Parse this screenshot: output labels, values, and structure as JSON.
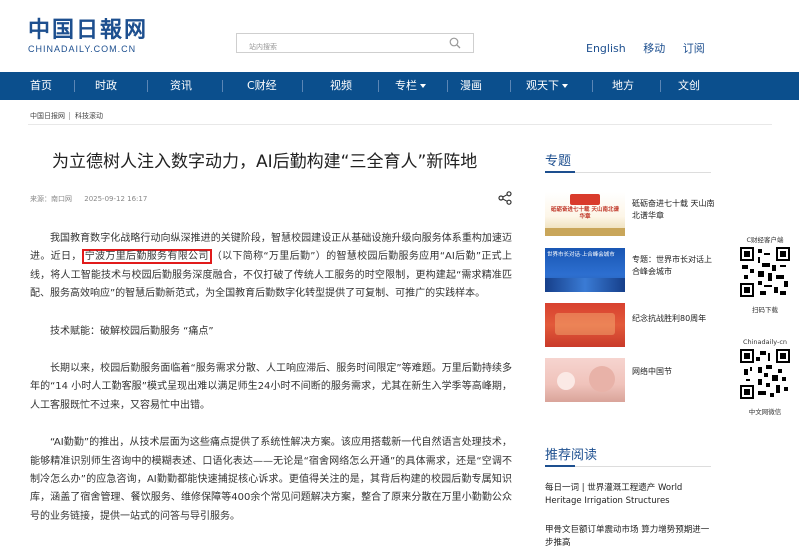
{
  "header": {
    "logo_main": "中国日報网",
    "logo_sub": "CHINADAILY.COM.CN",
    "search_placeholder": "站内搜索",
    "links": [
      "English",
      "移动",
      "订阅"
    ]
  },
  "nav": {
    "items": [
      "首页",
      "时政",
      "资讯",
      "C财经",
      "视频",
      "专栏",
      "漫画",
      "观天下",
      "地方",
      "文创"
    ],
    "dropdown_items": [
      "专栏",
      "观天下"
    ]
  },
  "breadcrumb": [
    "中国日报网",
    "科技滚动"
  ],
  "article": {
    "title": "为立德树人注入数字动力，AI后勤构建“三全育人”新阵地",
    "source": "来源：南口网",
    "date": "2025-09-12 16:17",
    "p1_a": "我国教育数字化战略行动向纵深推进的关键阶段，智慧校园建设正从基础设施升级向服务体系重构加速迈进。近日，",
    "p1_highlight": "宁波万里后勤服务有限公司",
    "p1_b": "（以下简称“万里后勤”）的智慧校园后勤服务应用“AI后勤”正式上线，将人工智能技术与校园后勤服务深度融合，不仅打破了传统人工服务的时空限制，更构建起“需求精准匹配、服务高效响应”的智慧后勤新范式，为全国教育后勤数字化转型提供了可复制、可推广的实践样本。",
    "p2": "技术赋能：破解校园后勤服务 “痛点”",
    "p3": "长期以来，校园后勤服务面临着“服务需求分散、人工响应滞后、服务时间限定”等难题。万里后勤持续多年的“14 小时人工勤客服”模式呈现出难以满足师生24小时不间断的服务需求，尤其在新生入学季等高峰期，人工客服既忙不过来，又容易忙中出错。",
    "p4": "“AI勤勤”的推出，从技术层面为这些痛点提供了系统性解决方案。该应用搭载新一代自然语言处理技术，能够精准识别师生咨询中的模糊表述、口语化表达——无论是“宿舍网络怎么开通”的具体需求，还是“空调不制冷怎么办”的应急咨询，AI勤勤都能快速捕捉核心诉求。更值得关注的是，其背后构建的校园后勤专属知识库，涵盖了宿舍管理、餐饮服务、维修保障等400余个常见问题解决方案，整合了原来分散在万里小勤勤公众号的业务链接，提供一站式的问答与导引服务。"
  },
  "sidebar": {
    "topics_title": "专题",
    "topics": [
      {
        "thumb_text": "砥砺奋进七十载 天山南北谱华章",
        "text": "砥砺奋进七十载 天山南北谱华章"
      },
      {
        "thumb_text": "世界市长对话·上合峰会城市",
        "text": "专题：世界市长对话上合峰会城市"
      },
      {
        "thumb_text": "",
        "text": "纪念抗战胜利80周年"
      },
      {
        "thumb_text": "",
        "text": "网络中国节"
      }
    ],
    "qr": [
      {
        "label_top": "C财经客户端",
        "label_bottom": "扫码下载"
      },
      {
        "label_top": "Chinadaily-cn",
        "label_bottom": "中文网微信"
      }
    ],
    "recommended_title": "推荐阅读",
    "recommended": [
      "每日一词 | 世界灌溉工程遗产 World Heritage Irrigation Structures",
      "甲骨文巨额订单震动市场 算力增势预期进一步推高"
    ]
  },
  "colors": {
    "brand_blue": "#1d4f8f",
    "nav_blue": "#0b4f8d",
    "highlight_red": "#e11b1b"
  }
}
